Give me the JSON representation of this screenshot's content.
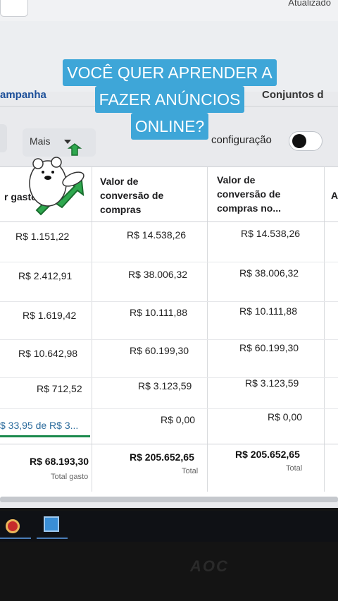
{
  "header": {
    "updated_text": "Atualizado"
  },
  "tabs": {
    "campaign": "ampanha",
    "ad_sets": "Conjuntos d"
  },
  "toolbar": {
    "more_label": "Mais",
    "config_label": "configuração"
  },
  "caption": {
    "lines": [
      "VOCÊ QUER APRENDER A",
      "FAZER ANÚNCIOS",
      "ONLINE?"
    ]
  },
  "table": {
    "headers": {
      "spent": "r gasto",
      "conv1": [
        "Valor de",
        "conversão de",
        "compras"
      ],
      "conv2": [
        "Valor de",
        "conversão de",
        "compras no..."
      ],
      "extra": "A"
    },
    "rows": [
      {
        "spent": "R$ 1.151,22",
        "conv1": "R$ 14.538,26",
        "conv2": "R$ 14.538,26"
      },
      {
        "spent": "R$ 2.412,91",
        "conv1": "R$ 38.006,32",
        "conv2": "R$ 38.006,32"
      },
      {
        "spent": "R$ 1.619,42",
        "conv1": "R$ 10.111,88",
        "conv2": "R$ 10.111,88"
      },
      {
        "spent": "R$ 10.642,98",
        "conv1": "R$ 60.199,30",
        "conv2": "R$ 60.199,30"
      },
      {
        "spent": "R$ 712,52",
        "conv1": "R$ 3.123,59",
        "conv2": "R$ 3.123,59"
      },
      {
        "spent": "$ 33,95 de R$ 3...",
        "conv1": "R$ 0,00",
        "conv2": "R$ 0,00"
      }
    ],
    "totals": {
      "spent": "R$ 68.193,30",
      "spent_label": "Total gasto",
      "conv1": "R$ 205.652,65",
      "conv1_label": "Total",
      "conv2": "R$ 205.652,65",
      "conv2_label": "Total"
    }
  },
  "monitor": {
    "brand": "AOC"
  },
  "colors": {
    "caption_bg": "#3ea6d8",
    "link_blue": "#1c4f99",
    "progress_green": "#1b8a4d"
  }
}
